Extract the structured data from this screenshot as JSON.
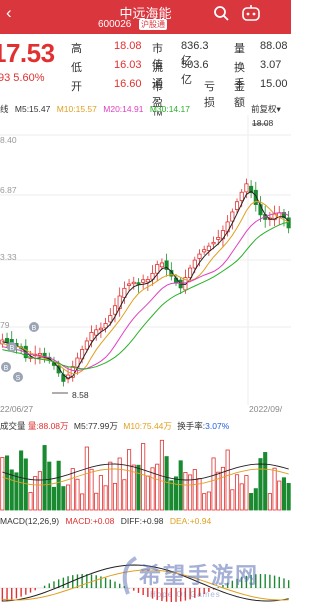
{
  "header": {
    "back": "‹",
    "title": "中远海能",
    "code": "600026",
    "market_tag": "沪股通",
    "search_icon": "search-icon",
    "assistant_icon": "robot-icon"
  },
  "quote": {
    "price": "17.53",
    "change": "93  5.60%",
    "rows": [
      {
        "l1": "高",
        "v1": "18.08",
        "l2": "市值",
        "v2": "836.3亿",
        "l3": "量",
        "v3": "88.08"
      },
      {
        "l1": "低",
        "v1": "16.03",
        "l2": "流通",
        "v2": "503.6亿",
        "l3": "换手",
        "v3": "3.07"
      },
      {
        "l1": "开",
        "v1": "16.60",
        "l2": "市盈™",
        "v2": "亏损",
        "l3": "金额",
        "v3": "15.00"
      }
    ]
  },
  "ma_legend": {
    "prefix": "线",
    "ma5": "M5:15.47",
    "ma10": "M10:15.57",
    "ma20": "M20:14.91",
    "ma30": "M30:14.17",
    "adjust": "前复权"
  },
  "price_axis": {
    "ticks": [
      "8.40",
      "6.87",
      "3.33",
      "79"
    ],
    "high_label": "18.08",
    "low_label": "8.58"
  },
  "dates": {
    "left": "22/06/27",
    "right": "2022/09/"
  },
  "volume_legend": {
    "prefix": "成交量",
    "vol": "量:88.08万",
    "m5": "M5:77.99万",
    "m10": "M10:75.44万",
    "turnover_label": "换手率:",
    "turnover": "3.07%"
  },
  "macd_legend": {
    "name": "MACD(12,26,9)",
    "macd": "MACD:+0.08",
    "diff": "DIFF:+0.98",
    "dea": "DEA:+0.94"
  },
  "markers": [
    "B",
    "B",
    "S",
    "B"
  ],
  "watermark": {
    "text": "希望手游网",
    "sub": "Hope Of Games"
  },
  "colors": {
    "up": "#e03030",
    "down": "#1a8a30",
    "ma5": "#222222",
    "ma10": "#e0a020",
    "ma20": "#e040c0",
    "ma30": "#28b028",
    "header": "#d9363e"
  }
}
